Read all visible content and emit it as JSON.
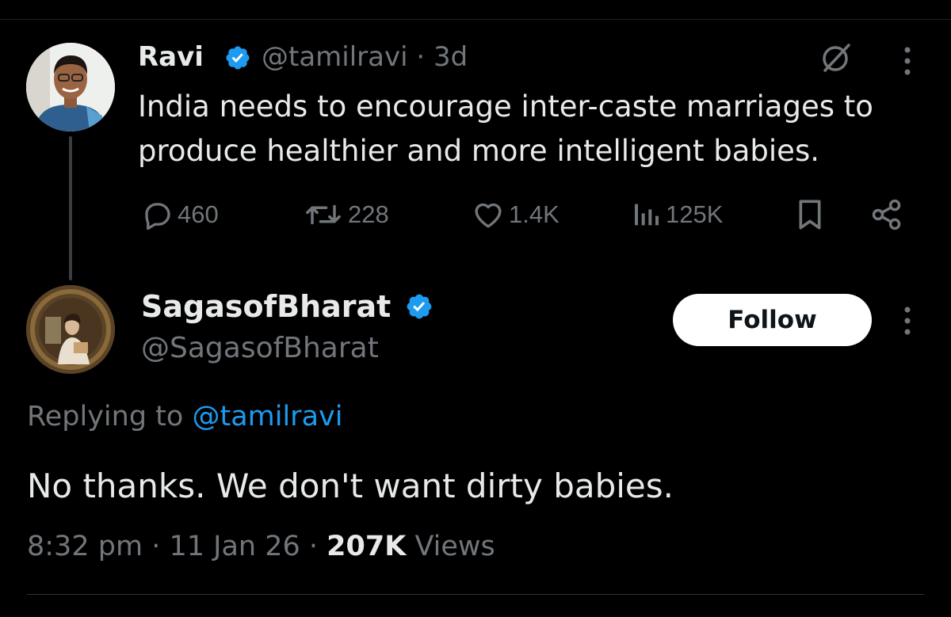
{
  "parent_tweet": {
    "author_name": "Ravi",
    "author_handle": "@tamilravi",
    "time_ago": "3d",
    "handle_time": "@tamilravi · 3d",
    "text": "India needs to encourage inter-caste marriages to produce healthier and more intelligent babies.",
    "stats": {
      "replies": "460",
      "reposts": "228",
      "likes": "1.4K",
      "views": "125K"
    },
    "icons": {
      "avatar": "avatar-photo",
      "verified": "verified-badge-icon",
      "grok": "grok-icon",
      "more": "more-vertical-icon",
      "reply": "reply-icon",
      "repost": "repost-icon",
      "like": "heart-icon",
      "views": "views-icon",
      "bookmark": "bookmark-icon",
      "share": "share-icon"
    }
  },
  "reply_tweet": {
    "author_name": "SagasofBharat",
    "author_handle": "@SagasofBharat",
    "follow_label": "Follow",
    "replying_prefix": "Replying to",
    "replying_handle": "@tamilravi",
    "text": "No thanks. We don't want dirty babies.",
    "time": "8:32 pm",
    "date": "11 Jan 26",
    "view_count": "207K",
    "view_label": "Views"
  },
  "colors": {
    "background": "#000000",
    "text_primary": "#e7e9ea",
    "text_secondary": "#71767b",
    "accent_blue": "#1d9bf0",
    "follow_bg": "#ffffff"
  }
}
